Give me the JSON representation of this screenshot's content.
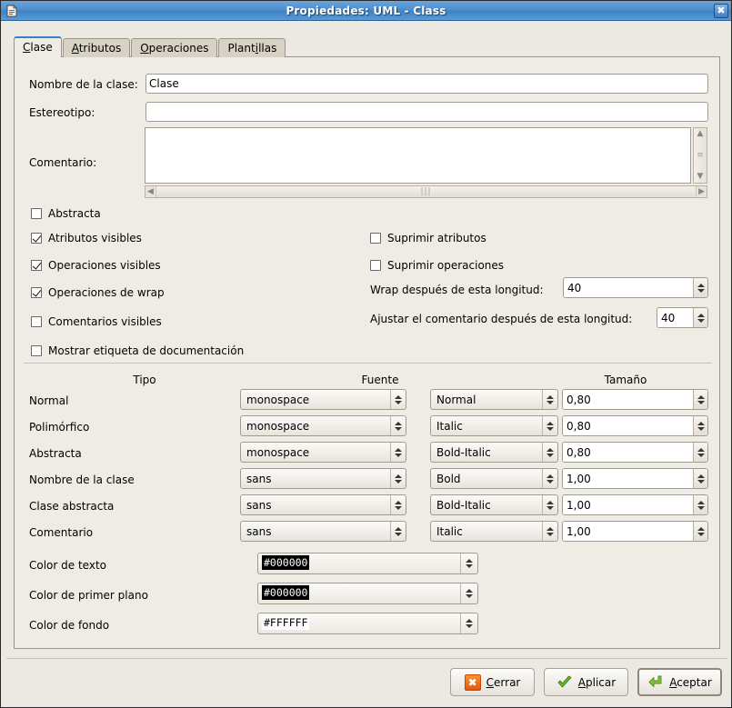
{
  "window": {
    "title": "Propiedades: UML - Class",
    "app_icon": "document-icon",
    "close_label": "✖"
  },
  "tabs": [
    {
      "id": "clase",
      "label": "Clase",
      "mnemonic": "C",
      "active": true
    },
    {
      "id": "atributos",
      "label": "Atributos",
      "mnemonic": "A",
      "active": false
    },
    {
      "id": "operaciones",
      "label": "Operaciones",
      "mnemonic": "O",
      "active": false
    },
    {
      "id": "plantillas",
      "label": "Plantillas",
      "mnemonic": "i",
      "active": false
    }
  ],
  "fields": {
    "class_name_label": "Nombre de la clase:",
    "class_name_value": "Clase",
    "stereotype_label": "Estereotipo:",
    "stereotype_value": "",
    "comment_label": "Comentario:",
    "comment_value": ""
  },
  "checkboxes_left": [
    {
      "label": "Abstracta",
      "checked": false
    },
    {
      "label": "Atributos visibles",
      "checked": true
    },
    {
      "label": "Operaciones visibles",
      "checked": true
    },
    {
      "label": "Operaciones de wrap",
      "checked": true
    },
    {
      "label": "Comentarios visibles",
      "checked": false
    },
    {
      "label": "Mostrar etiqueta de documentación",
      "checked": false
    }
  ],
  "checkboxes_right": [
    {
      "label": "Suprimir atributos",
      "checked": false
    },
    {
      "label": "Suprimir operaciones",
      "checked": false
    }
  ],
  "spinners": {
    "wrap_label": "Wrap después de esta longitud:",
    "wrap_value": "40",
    "comment_wrap_label": "Ajustar el comentario después de esta longitud:",
    "comment_wrap_value": "40"
  },
  "font_table": {
    "headers": {
      "type": "Tipo",
      "font": "Fuente",
      "size": "Tamaño"
    },
    "rows": [
      {
        "type": "Normal",
        "font": "monospace",
        "style": "Normal",
        "size": "0,80"
      },
      {
        "type": "Polimórfico",
        "font": "monospace",
        "style": "Italic",
        "size": "0,80"
      },
      {
        "type": "Abstracta",
        "font": "monospace",
        "style": "Bold-Italic",
        "size": "0,80"
      },
      {
        "type": "Nombre de la clase",
        "font": "sans",
        "style": "Bold",
        "size": "1,00"
      },
      {
        "type": "Clase abstracta",
        "font": "sans",
        "style": "Bold-Italic",
        "size": "1,00"
      },
      {
        "type": "Comentario",
        "font": "sans",
        "style": "Italic",
        "size": "1,00"
      }
    ]
  },
  "colors": [
    {
      "label": "Color de texto",
      "value": "#000000",
      "swatch_bg": "#000000",
      "swatch_fg": "#ffffff"
    },
    {
      "label": "Color de primer plano",
      "value": "#000000",
      "swatch_bg": "#000000",
      "swatch_fg": "#ffffff"
    },
    {
      "label": "Color de fondo",
      "value": "#FFFFFF",
      "swatch_bg": "#ffffff",
      "swatch_fg": "#000000"
    }
  ],
  "buttons": [
    {
      "id": "cerrar",
      "label": "Cerrar",
      "mnemonic": "C",
      "icon": "close-x-icon",
      "default": false
    },
    {
      "id": "aplicar",
      "label": "Aplicar",
      "mnemonic": "A",
      "icon": "check-icon",
      "default": false
    },
    {
      "id": "aceptar",
      "label": "Aceptar",
      "mnemonic": "A",
      "icon": "enter-arrow-icon",
      "default": true
    }
  ],
  "theme": {
    "titlebar_accent": "#3d83c6",
    "panel_bg": "#efece6",
    "dialog_bg": "#ece9e3",
    "active_tab_accent": "#3b7fc4",
    "close_icon_accent": "#e2570d",
    "check_icon_accent": "#67b82a"
  }
}
